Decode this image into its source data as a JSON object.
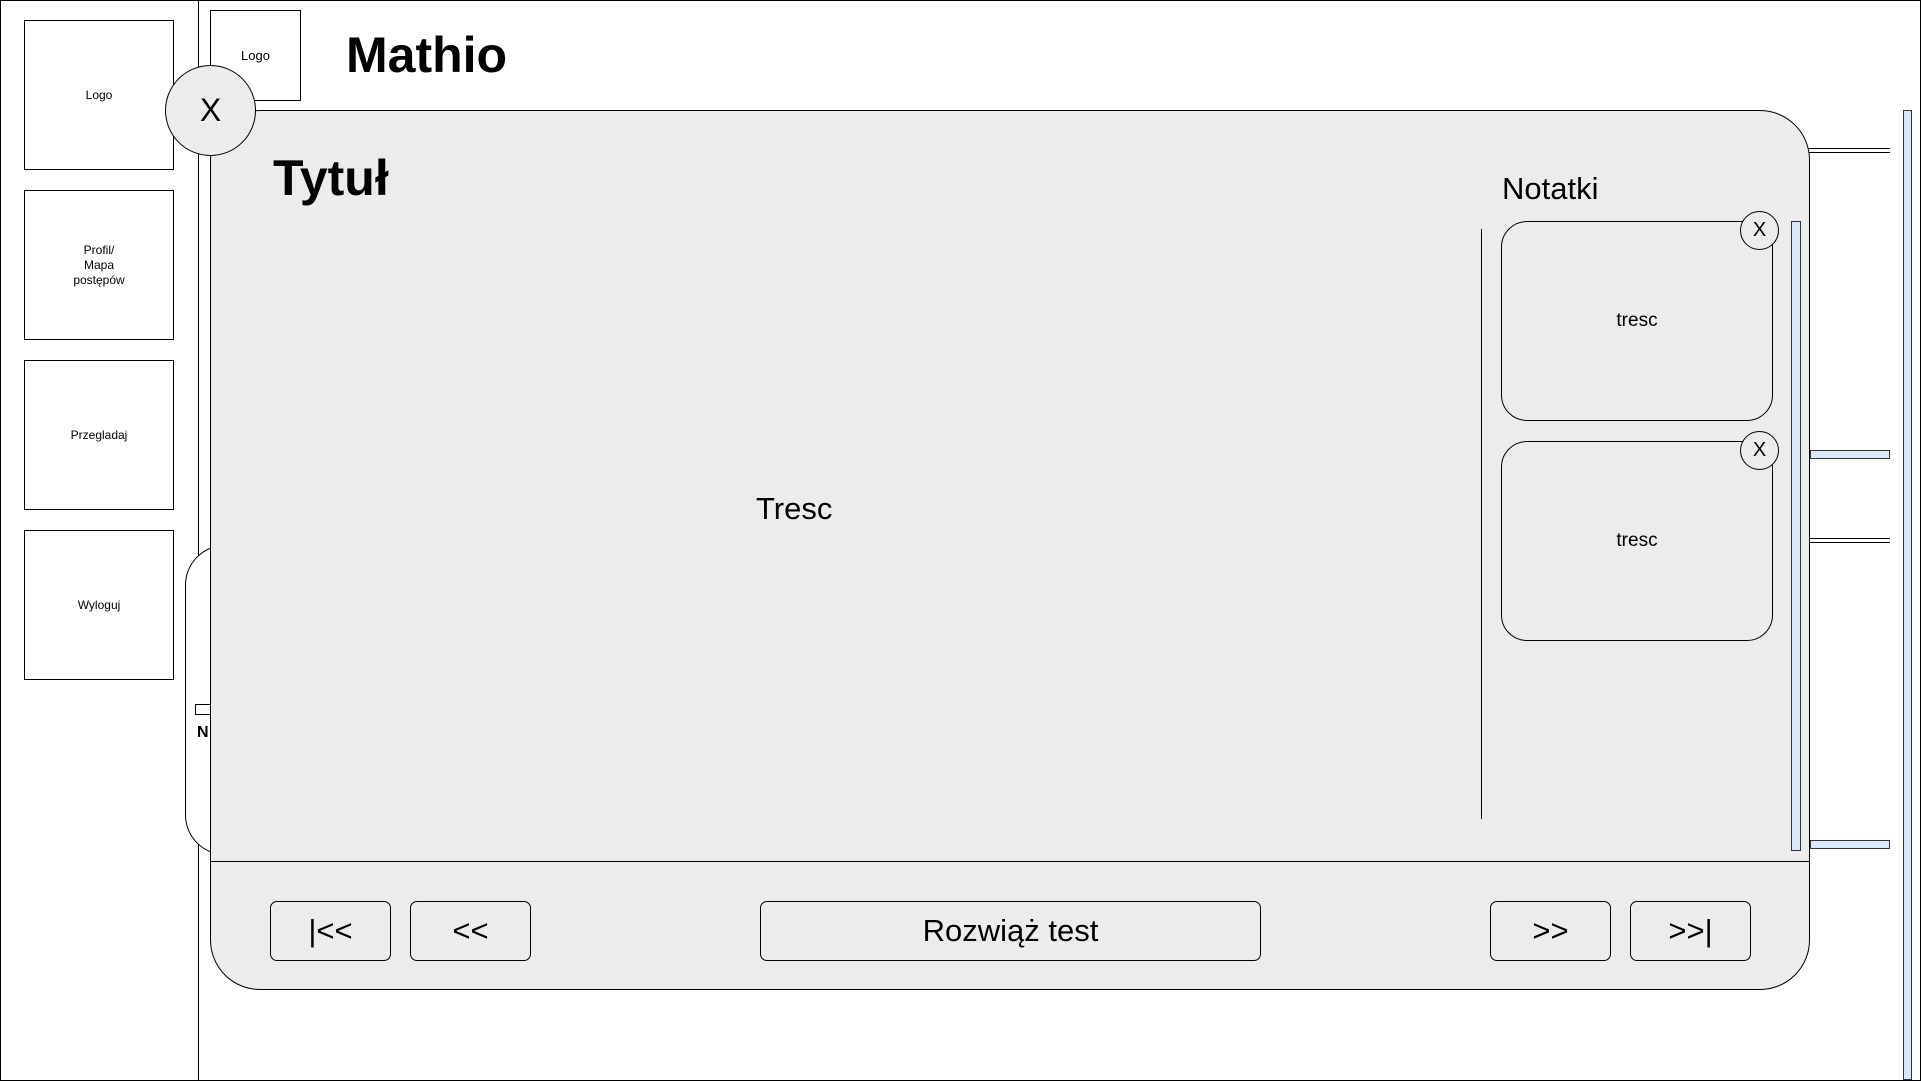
{
  "sidebar": {
    "items": [
      {
        "label": "Logo"
      },
      {
        "label": "Profil/\nMapa\npostępów"
      },
      {
        "label": "Przegladaj"
      },
      {
        "label": "Wyloguj"
      }
    ]
  },
  "header": {
    "logo": "Logo",
    "title": "Mathio"
  },
  "background": {
    "partial_label": "N"
  },
  "modal": {
    "close": "X",
    "title": "Tytuł",
    "content": "Tresc",
    "notes": {
      "title": "Notatki",
      "items": [
        {
          "text": "tresc",
          "close": "X"
        },
        {
          "text": "tresc",
          "close": "X"
        }
      ]
    },
    "footer": {
      "first": "|<<",
      "prev": "<<",
      "solve": "Rozwiąż test",
      "next": ">>",
      "last": ">>|"
    }
  },
  "colors": {
    "modal_bg": "#ececec",
    "scrollbar": "#dae8fc"
  }
}
